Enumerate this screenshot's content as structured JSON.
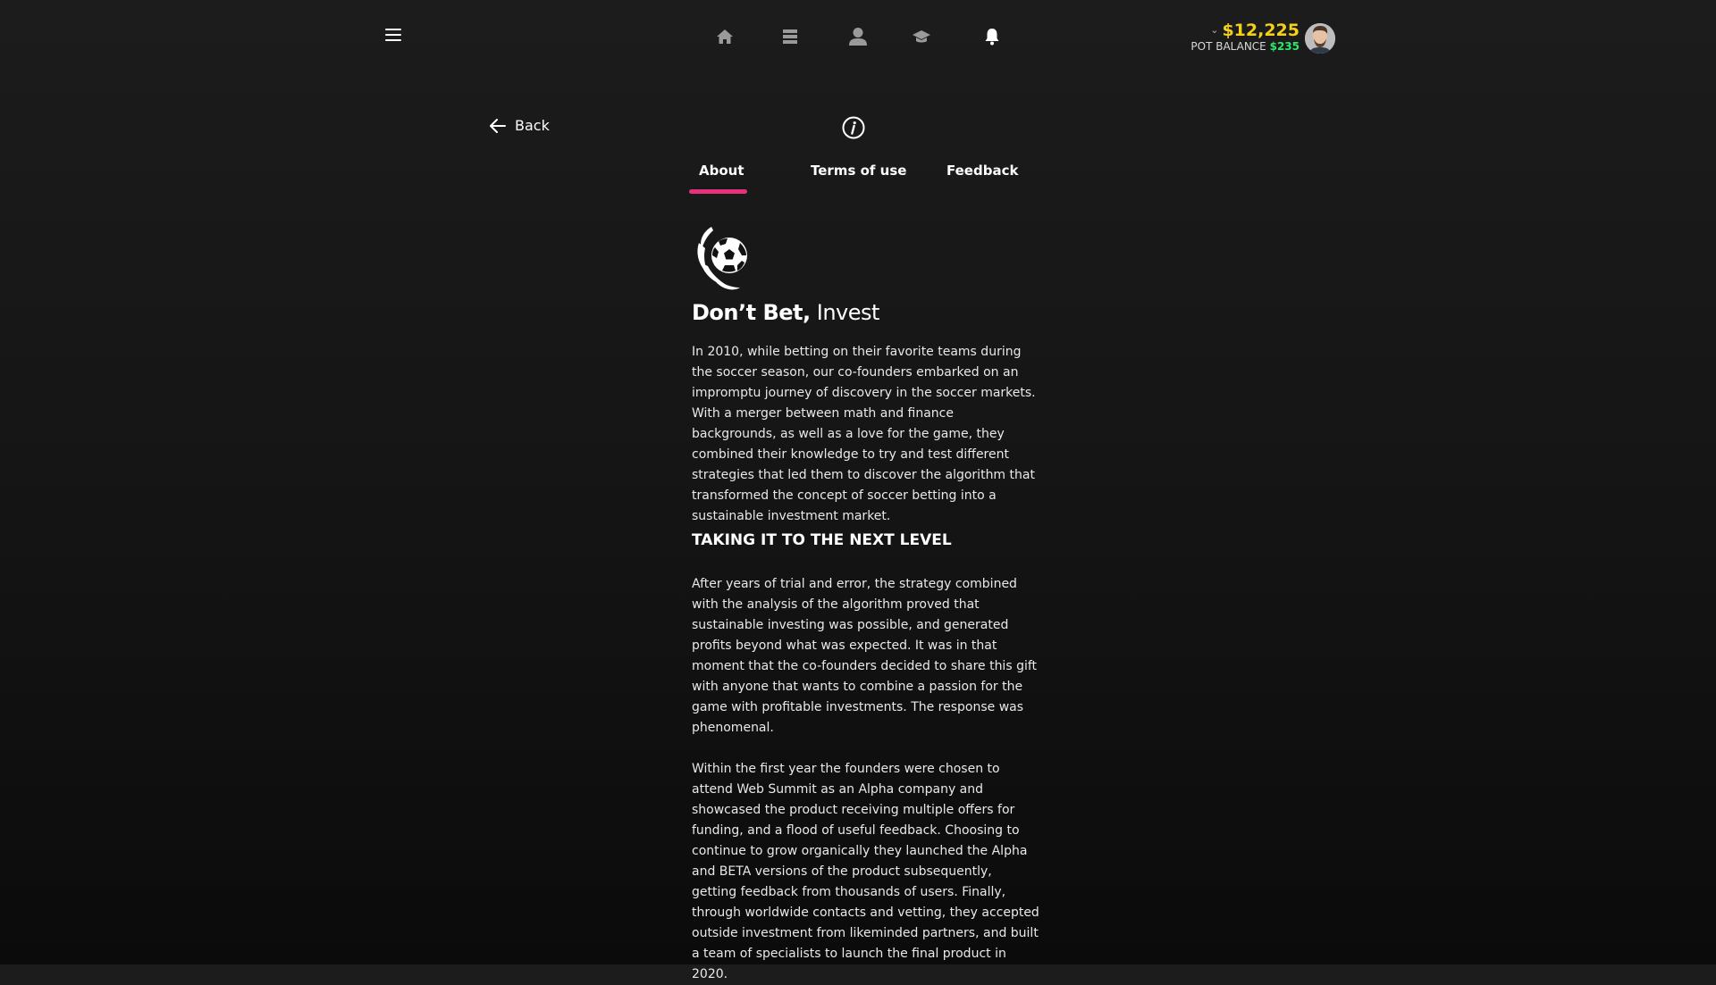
{
  "header": {
    "nav": [
      {
        "name": "home-icon",
        "active": false
      },
      {
        "name": "list-icon",
        "active": false
      },
      {
        "name": "user-icon",
        "active": false
      },
      {
        "name": "graduation-cap-icon",
        "active": false
      },
      {
        "name": "bell-icon",
        "active": true
      }
    ],
    "balance_amount": "$12,225",
    "pot_label": "POT BALANCE",
    "pot_value": "$235"
  },
  "page": {
    "back_label": "Back",
    "tabs": [
      {
        "label": "About",
        "active": true
      },
      {
        "label": "Terms of use",
        "active": false
      },
      {
        "label": "Feedback",
        "active": false
      }
    ]
  },
  "about": {
    "brand_bold": "Don’t Bet,",
    "brand_light": "Invest",
    "paragraph_1": "In 2010, while betting on their favorite teams during the soccer season, our co-founders embarked on an impromptu journey of discovery in the soccer markets. With a merger between math and finance backgrounds, as well as a love for the game, they combined their knowledge to try and test different strategies that led them to discover the algorithm that transformed the concept of soccer betting into a sustainable investment market.",
    "section_heading": "TAKING IT TO THE NEXT LEVEL",
    "paragraph_2": "After years of trial and error, the strategy combined with the analysis of the algorithm proved that sustainable investing was possible, and generated profits beyond what was expected. It was in that moment that the co-founders decided to share this gift with anyone that wants to combine a passion for the game with profitable investments. The response was phenomenal.",
    "paragraph_3": "Within the first year the founders were chosen to attend Web Summit as an Alpha company and showcased the product receiving multiple offers for funding, and a flood of useful feedback. Choosing to continue to grow organically they launched the Alpha and BETA versions of the product subsequently, getting feedback from thousands of users. Finally, through worldwide contacts and vetting, they accepted outside investment from likeminded partners, and built a team of specialists to launch the final product in 2020."
  },
  "colors": {
    "accent": "#e6317d",
    "balance": "#f5d019",
    "pot": "#2ee66b"
  }
}
